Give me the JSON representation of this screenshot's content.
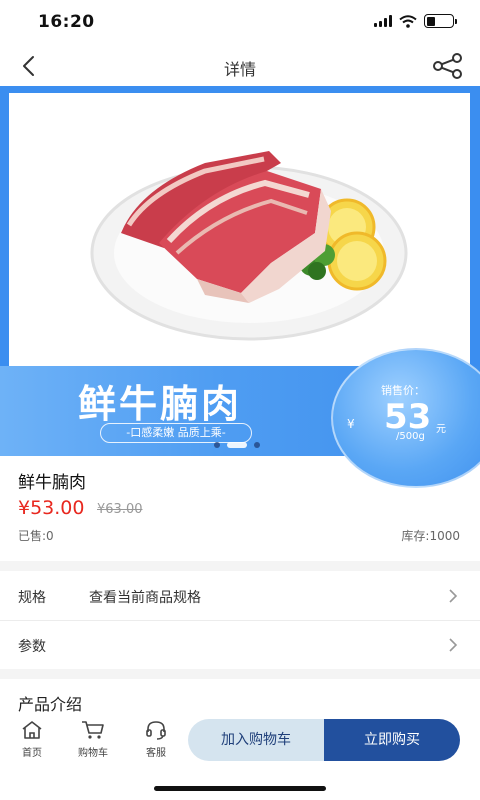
{
  "status_bar": {
    "time": "16:20",
    "battery_level": 0.35
  },
  "nav": {
    "title": "详情",
    "back_icon": "chevron-left-icon",
    "share_icon": "share-icon"
  },
  "banner": {
    "title": "鲜牛腩肉",
    "slogan": "-口感柔嫩 品质上乘-",
    "price_label": "销售价：",
    "currency": "¥",
    "price": "53",
    "price_unit": "元",
    "weight": "/500g",
    "slide_count": 3,
    "active_slide": 2,
    "colors": {
      "accent": "#3b8ef0",
      "strip": "#4f9df2"
    }
  },
  "product": {
    "name": "鲜牛腩肉",
    "price": "¥53.00",
    "original_price": "¥63.00",
    "sold": "已售:0",
    "stock": "库存:1000",
    "price_color": "#e8281f"
  },
  "rows": {
    "spec": {
      "label": "规格",
      "value": "查看当前商品规格"
    },
    "params": {
      "label": "参数"
    }
  },
  "section": {
    "intro_title": "产品介绍"
  },
  "bottom_bar": {
    "tabs": [
      {
        "label": "首页",
        "icon": "home-icon"
      },
      {
        "label": "购物车",
        "icon": "cart-icon"
      },
      {
        "label": "客服",
        "icon": "headset-icon"
      }
    ],
    "add_to_cart": "加入购物车",
    "buy_now": "立即购买",
    "colors": {
      "cart_bg": "#d5e4ef",
      "buy_bg": "#22509e"
    }
  }
}
